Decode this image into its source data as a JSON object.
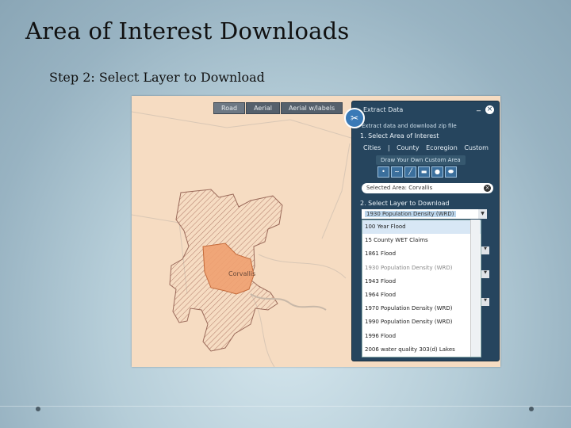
{
  "slide": {
    "title": "Area of Interest Downloads",
    "subtitle": "Step 2: Select Layer to Download"
  },
  "map": {
    "view_tabs": [
      "Road",
      "Aerial",
      "Aerial w/labels"
    ],
    "city_label": "Corvallis"
  },
  "panel": {
    "title": "Extract Data",
    "minimize_icon": "minimize-icon",
    "close_icon": "close-icon",
    "tool_icon": "scissors-icon",
    "description": "Extract data and download zip file",
    "section1": "1. Select Area of Interest",
    "area_tabs": [
      "Cities",
      "|",
      "County",
      "Ecoregion",
      "Custom"
    ],
    "draw_label": "Draw Your Own Custom Area",
    "draw_tools": [
      "point-tool-icon",
      "freehand-tool-icon",
      "line-tool-icon",
      "rectangle-tool-icon",
      "circle-tool-icon",
      "ellipse-tool-icon"
    ],
    "selected_area": "Selected Area: Corvallis",
    "section2": "2. Select Layer to Download",
    "dropdown_value": "1930 Population Density (WRD)",
    "layer_list": [
      "100 Year Flood",
      "15 County WET Claims",
      "1861 Flood",
      "1930 Population Density (WRD)",
      "1943 Flood",
      "1964 Flood",
      "1970 Population Density (WRD)",
      "1990 Population Density (WRD)",
      "1996 Flood",
      "2006 water quality 303(d) Lakes"
    ]
  },
  "colors": {
    "panel": "#26455e",
    "map_bg": "#f6dcc2",
    "selected_area": "#f0a070"
  }
}
